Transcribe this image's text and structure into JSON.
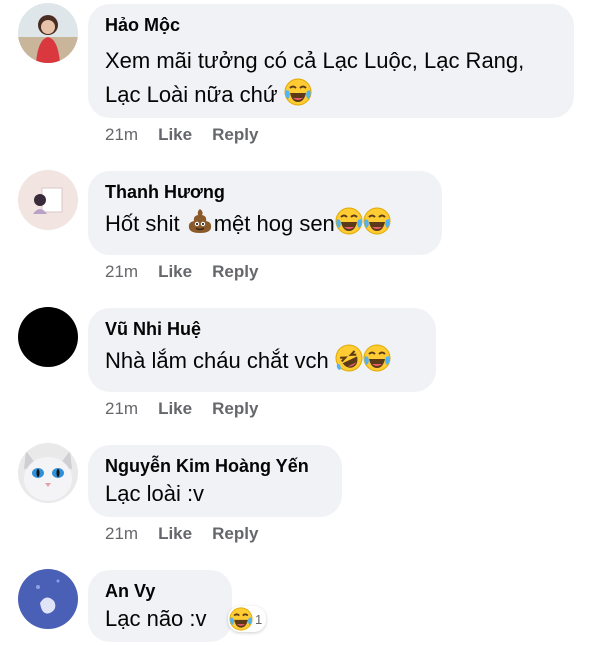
{
  "comments": [
    {
      "author": "Hảo Mộc",
      "line1": "Xem mãi tưởng có cả Lạc Luộc, Lạc Rang,",
      "line2": "Lạc Loài nữa chứ",
      "time": "21m",
      "like": "Like",
      "reply": "Reply"
    },
    {
      "author": "Thanh Hương",
      "line1": "Hốt shit",
      "line1b": "mệt hog sen",
      "time": "21m",
      "like": "Like",
      "reply": "Reply"
    },
    {
      "author": "Vũ Nhi Huệ",
      "line1": "Nhà lắm cháu chắt vch",
      "time": "21m",
      "like": "Like",
      "reply": "Reply"
    },
    {
      "author": "Nguyễn Kim Hoàng Yến",
      "line1": "Lạc loài :v",
      "time": "21m",
      "like": "Like",
      "reply": "Reply"
    },
    {
      "author": "An Vy",
      "line1": "Lạc não :v",
      "reaction_count": "1"
    }
  ],
  "colors": {
    "bubble": "#f0f2f5",
    "meta": "#65676b",
    "text": "#050505"
  },
  "icons": [
    "laughing-tears-emoji",
    "poop-emoji",
    "rofl-emoji",
    "haha-reaction"
  ]
}
